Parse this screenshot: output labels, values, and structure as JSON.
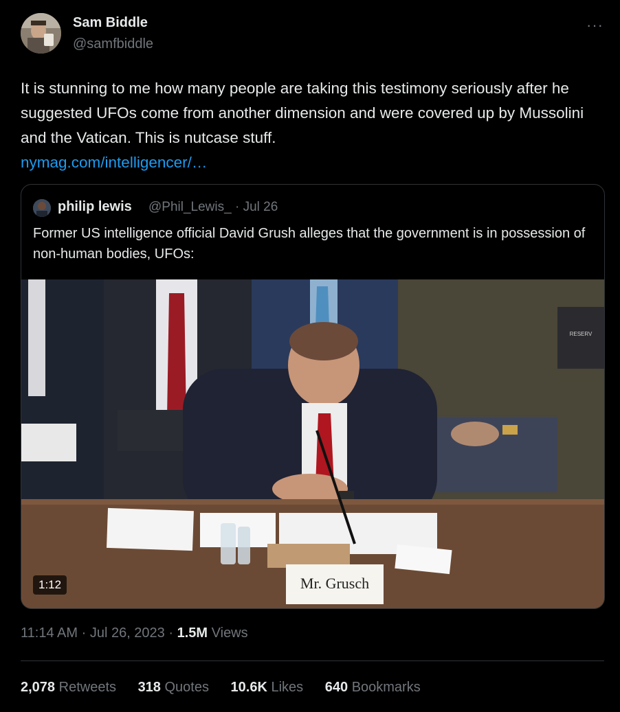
{
  "author": {
    "name": "Sam Biddle",
    "handle": "@samfbiddle"
  },
  "more_icon": "more-horizontal-icon",
  "tweet": {
    "text": "It is stunning to me how many people are taking this testimony seriously after he suggested UFOs come from another dimension and were covered up by Mussolini and the Vatican. This is nutcase stuff.",
    "link": "nymag.com/intelligencer/…"
  },
  "quoted_tweet": {
    "name": "philip lewis",
    "handle": "@Phil_Lewis_",
    "date": "· Jul 26",
    "text": "Former US intelligence official David Grush alleges that the government is in possession of non-human bodies, UFOs:",
    "video": {
      "duration": "1:12",
      "nameplate": "Mr. Grusch",
      "sign": "RESERV FOR WITNE"
    }
  },
  "meta": {
    "time": "11:14 AM",
    "date": "Jul 26, 2023",
    "views_count": "1.5M",
    "views_label": "Views"
  },
  "stats": {
    "retweets": {
      "count": "2,078",
      "label": "Retweets"
    },
    "quotes": {
      "count": "318",
      "label": "Quotes"
    },
    "likes": {
      "count": "10.6K",
      "label": "Likes"
    },
    "bookmarks": {
      "count": "640",
      "label": "Bookmarks"
    }
  },
  "colors": {
    "background": "#000000",
    "text": "#e7e9ea",
    "muted": "#71767b",
    "link": "#1d9bf0",
    "border": "#2f3336"
  }
}
